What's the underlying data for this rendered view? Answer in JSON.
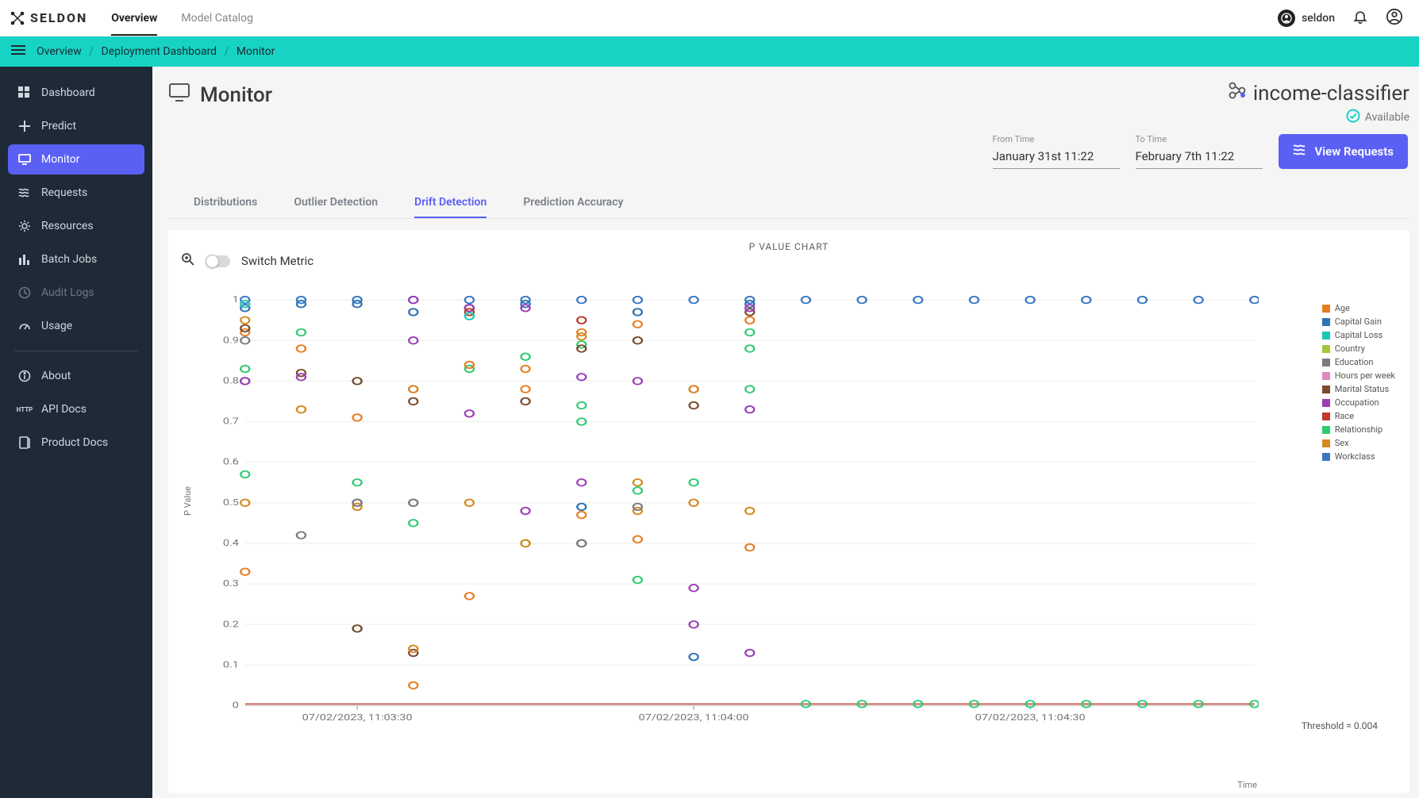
{
  "brand": "SELDON",
  "topnav": {
    "overview": "Overview",
    "catalog": "Model Catalog"
  },
  "user": {
    "name": "seldon"
  },
  "breadcrumbs": [
    "Overview",
    "Deployment Dashboard",
    "Monitor"
  ],
  "sidebar": {
    "items": [
      {
        "label": "Dashboard"
      },
      {
        "label": "Predict"
      },
      {
        "label": "Monitor"
      },
      {
        "label": "Requests"
      },
      {
        "label": "Resources"
      },
      {
        "label": "Batch Jobs"
      },
      {
        "label": "Audit Logs"
      },
      {
        "label": "Usage"
      }
    ],
    "secondary": [
      {
        "label": "About"
      },
      {
        "label": "API Docs"
      },
      {
        "label": "Product Docs"
      }
    ]
  },
  "page": {
    "title": "Monitor"
  },
  "deployment": {
    "name": "income-classifier",
    "status": "Available"
  },
  "time": {
    "from_label": "From Time",
    "from_value": "January 31st 11:22",
    "to_label": "To Time",
    "to_value": "February 7th 11:22"
  },
  "actions": {
    "view_requests": "View Requests"
  },
  "tabs": {
    "distributions": "Distributions",
    "outlier": "Outlier Detection",
    "drift": "Drift Detection",
    "accuracy": "Prediction Accuracy"
  },
  "chart_toolbar": {
    "switch_metric": "Switch Metric"
  },
  "chart_data": {
    "type": "scatter",
    "title": "P VALUE CHART",
    "xlabel": "Time",
    "ylabel": "P Value",
    "ylim": [
      0,
      1
    ],
    "y_ticks": [
      0,
      0.1,
      0.2,
      0.3,
      0.4,
      0.5,
      0.6,
      0.7,
      0.8,
      0.9,
      1
    ],
    "x_tick_labels": [
      "07/02/2023, 11:03:30",
      "07/02/2023, 11:04:00",
      "07/02/2023, 11:04:30"
    ],
    "x_tick_positions": [
      2,
      8,
      14
    ],
    "threshold": 0.004,
    "threshold_label": "Threshold = 0.004",
    "legend": [
      {
        "name": "Age",
        "color": "#e67e22"
      },
      {
        "name": "Capital Gain",
        "color": "#2e74b5"
      },
      {
        "name": "Capital Loss",
        "color": "#1bc6b4"
      },
      {
        "name": "Country",
        "color": "#a3c63b"
      },
      {
        "name": "Education",
        "color": "#7c7c7c"
      },
      {
        "name": "Hours per week",
        "color": "#e089c4"
      },
      {
        "name": "Marital Status",
        "color": "#7b4a2d"
      },
      {
        "name": "Occupation",
        "color": "#9b3fb5"
      },
      {
        "name": "Race",
        "color": "#c0392b"
      },
      {
        "name": "Relationship",
        "color": "#2ecc71"
      },
      {
        "name": "Sex",
        "color": "#d58a1e"
      },
      {
        "name": "Workclass",
        "color": "#3a78c3"
      }
    ],
    "series": [
      {
        "name": "Workclass",
        "color": "#3a78c3",
        "points": [
          [
            0,
            1
          ],
          [
            1,
            1
          ],
          [
            2,
            1
          ],
          [
            3,
            1
          ],
          [
            4,
            1
          ],
          [
            5,
            1
          ],
          [
            6,
            1
          ],
          [
            7,
            1
          ],
          [
            8,
            1
          ],
          [
            9,
            1
          ],
          [
            10,
            1
          ],
          [
            11,
            1
          ],
          [
            12,
            1
          ],
          [
            13,
            1
          ],
          [
            14,
            1
          ],
          [
            15,
            1
          ],
          [
            16,
            1
          ],
          [
            17,
            1
          ],
          [
            18,
            1
          ]
        ]
      },
      {
        "name": "Capital Gain",
        "color": "#2e74b5",
        "points": [
          [
            0,
            0.98
          ],
          [
            1,
            0.99
          ],
          [
            2,
            0.99
          ],
          [
            3,
            0.97
          ],
          [
            4,
            0.98
          ],
          [
            5,
            0.99
          ],
          [
            6,
            0.49
          ],
          [
            7,
            0.97
          ],
          [
            8,
            0.12
          ],
          [
            9,
            0.99
          ]
        ]
      },
      {
        "name": "Relationship",
        "color": "#2ecc71",
        "points": [
          [
            0,
            0.83
          ],
          [
            0,
            0.57
          ],
          [
            1,
            0.92
          ],
          [
            2,
            0.8
          ],
          [
            2,
            0.55
          ],
          [
            2,
            0.19
          ],
          [
            3,
            0.78
          ],
          [
            3,
            0.45
          ],
          [
            4,
            0.83
          ],
          [
            5,
            0.86
          ],
          [
            5,
            0.4
          ],
          [
            6,
            0.89
          ],
          [
            6,
            0.7
          ],
          [
            6,
            0.74
          ],
          [
            7,
            0.53
          ],
          [
            7,
            0.31
          ],
          [
            8,
            0.78
          ],
          [
            8,
            0.55
          ],
          [
            9,
            0.92
          ],
          [
            9,
            0.88
          ],
          [
            9,
            0.78
          ],
          [
            10,
            0.004
          ],
          [
            11,
            0.004
          ],
          [
            12,
            0.004
          ],
          [
            13,
            0.004
          ],
          [
            14,
            0.004
          ],
          [
            15,
            0.004
          ],
          [
            16,
            0.004
          ],
          [
            17,
            0.004
          ],
          [
            18,
            0.004
          ]
        ]
      },
      {
        "name": "Age",
        "color": "#e67e22",
        "points": [
          [
            0,
            0.92
          ],
          [
            0,
            0.33
          ],
          [
            1,
            0.88
          ],
          [
            2,
            0.71
          ],
          [
            3,
            0.78
          ],
          [
            3,
            0.05
          ],
          [
            4,
            0.84
          ],
          [
            4,
            0.27
          ],
          [
            5,
            0.83
          ],
          [
            5,
            0.78
          ],
          [
            6,
            0.92
          ],
          [
            6,
            0.47
          ],
          [
            7,
            0.94
          ],
          [
            7,
            0.41
          ],
          [
            8,
            0.78
          ],
          [
            9,
            0.95
          ],
          [
            9,
            0.39
          ]
        ]
      },
      {
        "name": "Marital Status",
        "color": "#7b4a2d",
        "points": [
          [
            0,
            0.93
          ],
          [
            0,
            0.8
          ],
          [
            1,
            0.82
          ],
          [
            2,
            0.8
          ],
          [
            2,
            0.19
          ],
          [
            3,
            0.75
          ],
          [
            3,
            0.13
          ],
          [
            4,
            0.98
          ],
          [
            5,
            0.75
          ],
          [
            6,
            0.88
          ],
          [
            6,
            0.4
          ],
          [
            7,
            0.9
          ],
          [
            8,
            0.74
          ],
          [
            9,
            0.97
          ]
        ]
      },
      {
        "name": "Occupation",
        "color": "#9b3fb5",
        "points": [
          [
            0,
            0.8
          ],
          [
            1,
            0.81
          ],
          [
            2,
            0.5
          ],
          [
            3,
            1.0
          ],
          [
            3,
            0.9
          ],
          [
            4,
            0.98
          ],
          [
            4,
            0.72
          ],
          [
            5,
            0.98
          ],
          [
            5,
            0.48
          ],
          [
            6,
            0.81
          ],
          [
            6,
            0.55
          ],
          [
            7,
            0.8
          ],
          [
            8,
            0.29
          ],
          [
            8,
            0.2
          ],
          [
            9,
            0.98
          ],
          [
            9,
            0.73
          ],
          [
            9,
            0.13
          ]
        ]
      },
      {
        "name": "Sex",
        "color": "#d58a1e",
        "points": [
          [
            0,
            0.95
          ],
          [
            0,
            0.5
          ],
          [
            1,
            0.73
          ],
          [
            2,
            0.49
          ],
          [
            3,
            0.5
          ],
          [
            3,
            0.14
          ],
          [
            4,
            0.5
          ],
          [
            5,
            0.4
          ],
          [
            6,
            0.91
          ],
          [
            7,
            0.55
          ],
          [
            7,
            0.48
          ],
          [
            8,
            0.5
          ],
          [
            9,
            0.48
          ]
        ]
      },
      {
        "name": "Education",
        "color": "#7c7c7c",
        "points": [
          [
            0,
            0.9
          ],
          [
            1,
            0.42
          ],
          [
            2,
            0.5
          ],
          [
            3,
            0.5
          ],
          [
            6,
            0.4
          ],
          [
            7,
            0.49
          ]
        ]
      },
      {
        "name": "Race",
        "color": "#c0392b",
        "points": [
          [
            4,
            0.97
          ],
          [
            6,
            0.95
          ]
        ]
      },
      {
        "name": "Capital Loss",
        "color": "#1bc6b4",
        "points": [
          [
            0,
            0.99
          ],
          [
            4,
            0.96
          ]
        ]
      }
    ]
  }
}
